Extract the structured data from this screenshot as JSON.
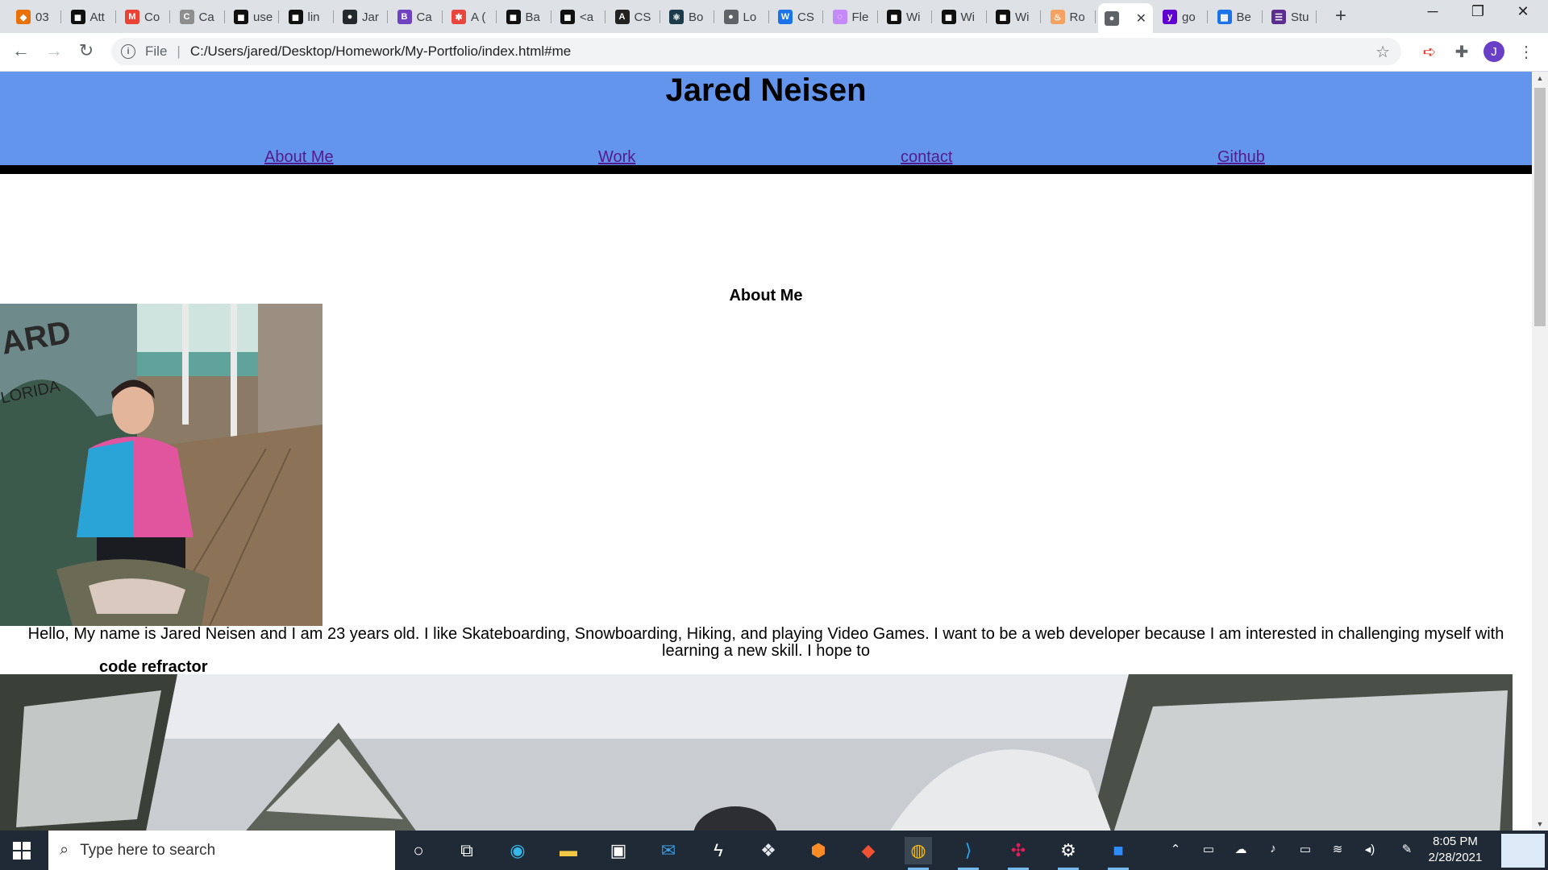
{
  "browser": {
    "tabs": [
      {
        "label": "03",
        "color": "#e8710a",
        "glyph": "◆"
      },
      {
        "label": "Att",
        "color": "#111111",
        "glyph": "◼"
      },
      {
        "label": "Co",
        "color": "#ea4335",
        "glyph": "M"
      },
      {
        "label": "Ca",
        "color": "#8e8e8e",
        "glyph": "C"
      },
      {
        "label": "use",
        "color": "#111111",
        "glyph": "◼"
      },
      {
        "label": "lin",
        "color": "#111111",
        "glyph": "◼"
      },
      {
        "label": "Jar",
        "color": "#24292e",
        "glyph": "●"
      },
      {
        "label": "Ca",
        "color": "#6f42c1",
        "glyph": "B"
      },
      {
        "label": "A (",
        "color": "#e8453c",
        "glyph": "✱"
      },
      {
        "label": "Ba",
        "color": "#111111",
        "glyph": "◼"
      },
      {
        "label": "<a",
        "color": "#111111",
        "glyph": "◼"
      },
      {
        "label": "CS",
        "color": "#222222",
        "glyph": "A"
      },
      {
        "label": "Bo",
        "color": "#1b3a4b",
        "glyph": "⚛"
      },
      {
        "label": "Lo",
        "color": "#5f6368",
        "glyph": "●"
      },
      {
        "label": "CS",
        "color": "#1a73e8",
        "glyph": "W"
      },
      {
        "label": "Fle",
        "color": "#c58af9",
        "glyph": "◌"
      },
      {
        "label": "Wi",
        "color": "#111111",
        "glyph": "◼"
      },
      {
        "label": "Wi",
        "color": "#111111",
        "glyph": "◼"
      },
      {
        "label": "Wi",
        "color": "#111111",
        "glyph": "◼"
      },
      {
        "label": "Ro",
        "color": "#f4a261",
        "glyph": "♨"
      },
      {
        "label": "",
        "color": "#5f6368",
        "glyph": "●",
        "active": true
      },
      {
        "label": "go",
        "color": "#6001d2",
        "glyph": "y"
      },
      {
        "label": "Be",
        "color": "#1a73e8",
        "glyph": "▦"
      },
      {
        "label": "Stu",
        "color": "#5c2d91",
        "glyph": "☰"
      }
    ],
    "new_tab": "+",
    "window_controls": {
      "minimize": "─",
      "restore": "❐",
      "close": "✕"
    },
    "address": {
      "scheme_label": "File",
      "url": "C:/Users/jared/Desktop/Homework/My-Portfolio/index.html#me"
    },
    "profile_initial": "J"
  },
  "page": {
    "site_title": "Jared Neisen",
    "nav": [
      {
        "label": "About Me"
      },
      {
        "label": "Work"
      },
      {
        "label": "contact"
      },
      {
        "label": "Github"
      }
    ],
    "about_heading": "About Me",
    "bio": "Hello, My name is Jared Neisen and I am 23 years old. I like Skateboarding, Snowboarding, Hiking, and playing Video Games. I want to be a web developer because I am interested in challenging myself with learning a new skill. I hope to",
    "project_title": "code refractor"
  },
  "taskbar": {
    "search_placeholder": "Type here to search",
    "time": "8:05 PM",
    "date": "2/28/2021",
    "apps": [
      "cortana-icon",
      "task-view-icon",
      "edge-icon",
      "file-explorer-icon",
      "store-icon",
      "mail-icon",
      "lightning-app-icon",
      "dropbox-icon",
      "brave-icon",
      "git-icon",
      "chrome-icon",
      "vscode-icon",
      "slack-icon",
      "settings-icon",
      "zoom-icon"
    ]
  }
}
